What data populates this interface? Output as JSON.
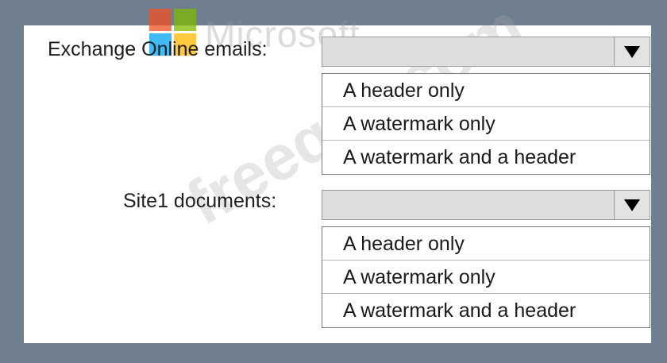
{
  "logo": {
    "text": "Microsoft",
    "colors": [
      "#f25022",
      "#7fba00",
      "#00a4ef",
      "#ffb900"
    ]
  },
  "watermark": "freeqas.com",
  "rows": [
    {
      "label": "Exchange Online emails:",
      "selected": "",
      "options": [
        "A header only",
        "A watermark only",
        "A watermark and a header"
      ]
    },
    {
      "label": "Site1 documents:",
      "selected": "",
      "options": [
        "A header only",
        "A watermark only",
        "A watermark and a header"
      ]
    }
  ]
}
